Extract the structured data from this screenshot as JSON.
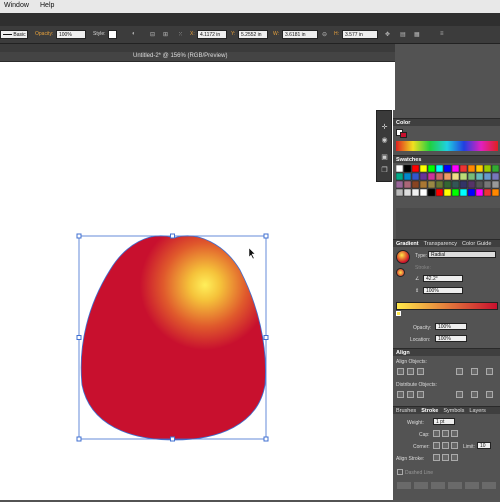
{
  "menubar": {
    "items": [
      "Window",
      "Help"
    ]
  },
  "control": {
    "stroke_style": "Basic",
    "opacity_label": "Opacity:",
    "opacity_value": "100%",
    "style_label": "Style:",
    "x_label": "X:",
    "x_value": "4.1172 in",
    "y_label": "Y:",
    "y_value": "5.2552 in",
    "w_label": "W:",
    "w_value": "3.6181 in",
    "h_label": "H:",
    "h_value": "3.577 in"
  },
  "document": {
    "tab_title": "Untitled-2* @ 156% (RGB/Preview)"
  },
  "panels": {
    "color_title": "Color",
    "swatches_title": "Swatches",
    "gradient_tabs": [
      "Gradient",
      "Transparency",
      "Color Guide"
    ],
    "gradient": {
      "type_label": "Type:",
      "type_value": "Radial",
      "stroke_label": "Stroke:",
      "angle_value": "42.2°",
      "aspect_value": "100%",
      "opacity_label": "Opacity:",
      "opacity_value": "100%",
      "location_label": "Location:",
      "location_value": "100%"
    },
    "align_title": "Align",
    "align_objects_label": "Align Objects:",
    "distribute_objects_label": "Distribute Objects:",
    "stroke_tabs": [
      "Brushes",
      "Stroke",
      "Symbols",
      "Layers"
    ],
    "stroke": {
      "weight_label": "Weight:",
      "weight_value": "1 pt",
      "cap_label": "Cap:",
      "corner_label": "Corner:",
      "limit_label": "Limit:",
      "limit_value": "10",
      "align_stroke_label": "Align Stroke:",
      "dashed_line_label": "Dashed Line"
    }
  },
  "colors": {
    "shape_red": "#c8102e",
    "highlight_yellow": "#ffe84a",
    "selection_blue": "#3f6fd1",
    "app_dark": "#535353"
  }
}
